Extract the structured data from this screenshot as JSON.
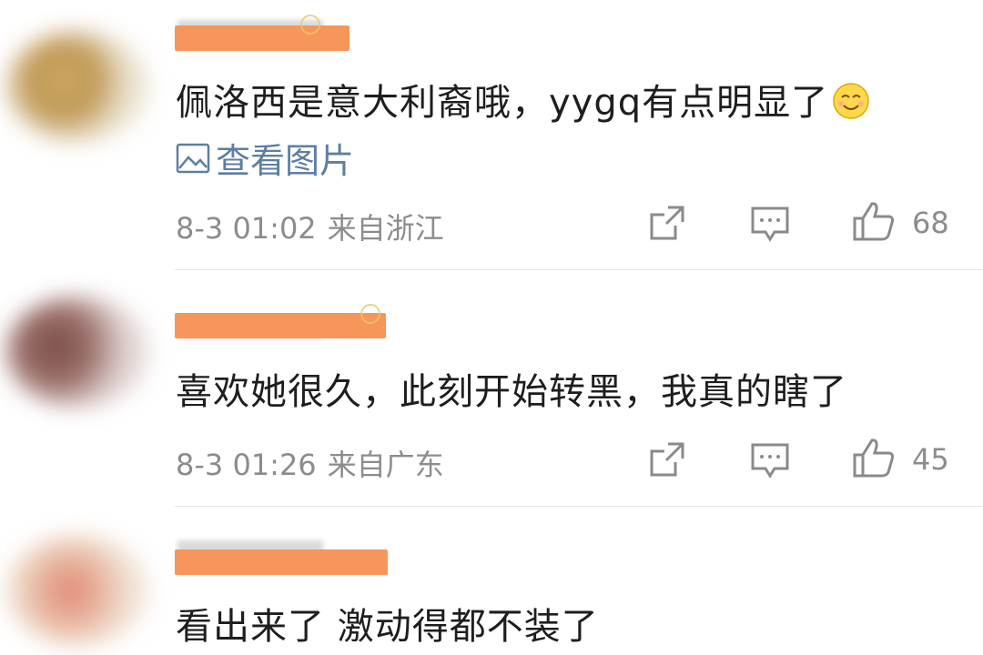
{
  "comments": [
    {
      "text": "佩洛西是意大利裔哦，yygq有点明显了",
      "emoji": "smiling-face-emoji",
      "view_images": "查看图片",
      "time": "8-3 01:02",
      "location": "来自浙江",
      "likes": "68"
    },
    {
      "text": "喜欢她很久，此刻开始转黑，我真的瞎了",
      "time": "8-3 01:26",
      "location": "来自广东",
      "likes": "45"
    },
    {
      "text": "看出来了 激动得都不装了"
    }
  ],
  "colors": {
    "redaction": "#f7965a",
    "link": "#5d7ea3",
    "meta": "#8c8c8c",
    "text": "#1e1e1e"
  }
}
